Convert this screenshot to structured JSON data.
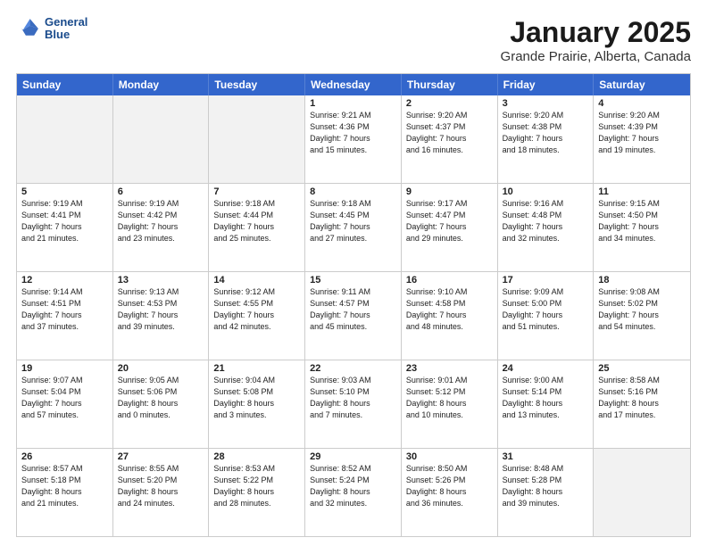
{
  "header": {
    "logo_line1": "General",
    "logo_line2": "Blue",
    "month": "January 2025",
    "location": "Grande Prairie, Alberta, Canada"
  },
  "days_of_week": [
    "Sunday",
    "Monday",
    "Tuesday",
    "Wednesday",
    "Thursday",
    "Friday",
    "Saturday"
  ],
  "weeks": [
    [
      {
        "day": "",
        "info": "",
        "shaded": true
      },
      {
        "day": "",
        "info": "",
        "shaded": true
      },
      {
        "day": "",
        "info": "",
        "shaded": true
      },
      {
        "day": "1",
        "info": "Sunrise: 9:21 AM\nSunset: 4:36 PM\nDaylight: 7 hours\nand 15 minutes.",
        "shaded": false
      },
      {
        "day": "2",
        "info": "Sunrise: 9:20 AM\nSunset: 4:37 PM\nDaylight: 7 hours\nand 16 minutes.",
        "shaded": false
      },
      {
        "day": "3",
        "info": "Sunrise: 9:20 AM\nSunset: 4:38 PM\nDaylight: 7 hours\nand 18 minutes.",
        "shaded": false
      },
      {
        "day": "4",
        "info": "Sunrise: 9:20 AM\nSunset: 4:39 PM\nDaylight: 7 hours\nand 19 minutes.",
        "shaded": false
      }
    ],
    [
      {
        "day": "5",
        "info": "Sunrise: 9:19 AM\nSunset: 4:41 PM\nDaylight: 7 hours\nand 21 minutes.",
        "shaded": false
      },
      {
        "day": "6",
        "info": "Sunrise: 9:19 AM\nSunset: 4:42 PM\nDaylight: 7 hours\nand 23 minutes.",
        "shaded": false
      },
      {
        "day": "7",
        "info": "Sunrise: 9:18 AM\nSunset: 4:44 PM\nDaylight: 7 hours\nand 25 minutes.",
        "shaded": false
      },
      {
        "day": "8",
        "info": "Sunrise: 9:18 AM\nSunset: 4:45 PM\nDaylight: 7 hours\nand 27 minutes.",
        "shaded": false
      },
      {
        "day": "9",
        "info": "Sunrise: 9:17 AM\nSunset: 4:47 PM\nDaylight: 7 hours\nand 29 minutes.",
        "shaded": false
      },
      {
        "day": "10",
        "info": "Sunrise: 9:16 AM\nSunset: 4:48 PM\nDaylight: 7 hours\nand 32 minutes.",
        "shaded": false
      },
      {
        "day": "11",
        "info": "Sunrise: 9:15 AM\nSunset: 4:50 PM\nDaylight: 7 hours\nand 34 minutes.",
        "shaded": false
      }
    ],
    [
      {
        "day": "12",
        "info": "Sunrise: 9:14 AM\nSunset: 4:51 PM\nDaylight: 7 hours\nand 37 minutes.",
        "shaded": false
      },
      {
        "day": "13",
        "info": "Sunrise: 9:13 AM\nSunset: 4:53 PM\nDaylight: 7 hours\nand 39 minutes.",
        "shaded": false
      },
      {
        "day": "14",
        "info": "Sunrise: 9:12 AM\nSunset: 4:55 PM\nDaylight: 7 hours\nand 42 minutes.",
        "shaded": false
      },
      {
        "day": "15",
        "info": "Sunrise: 9:11 AM\nSunset: 4:57 PM\nDaylight: 7 hours\nand 45 minutes.",
        "shaded": false
      },
      {
        "day": "16",
        "info": "Sunrise: 9:10 AM\nSunset: 4:58 PM\nDaylight: 7 hours\nand 48 minutes.",
        "shaded": false
      },
      {
        "day": "17",
        "info": "Sunrise: 9:09 AM\nSunset: 5:00 PM\nDaylight: 7 hours\nand 51 minutes.",
        "shaded": false
      },
      {
        "day": "18",
        "info": "Sunrise: 9:08 AM\nSunset: 5:02 PM\nDaylight: 7 hours\nand 54 minutes.",
        "shaded": false
      }
    ],
    [
      {
        "day": "19",
        "info": "Sunrise: 9:07 AM\nSunset: 5:04 PM\nDaylight: 7 hours\nand 57 minutes.",
        "shaded": false
      },
      {
        "day": "20",
        "info": "Sunrise: 9:05 AM\nSunset: 5:06 PM\nDaylight: 8 hours\nand 0 minutes.",
        "shaded": false
      },
      {
        "day": "21",
        "info": "Sunrise: 9:04 AM\nSunset: 5:08 PM\nDaylight: 8 hours\nand 3 minutes.",
        "shaded": false
      },
      {
        "day": "22",
        "info": "Sunrise: 9:03 AM\nSunset: 5:10 PM\nDaylight: 8 hours\nand 7 minutes.",
        "shaded": false
      },
      {
        "day": "23",
        "info": "Sunrise: 9:01 AM\nSunset: 5:12 PM\nDaylight: 8 hours\nand 10 minutes.",
        "shaded": false
      },
      {
        "day": "24",
        "info": "Sunrise: 9:00 AM\nSunset: 5:14 PM\nDaylight: 8 hours\nand 13 minutes.",
        "shaded": false
      },
      {
        "day": "25",
        "info": "Sunrise: 8:58 AM\nSunset: 5:16 PM\nDaylight: 8 hours\nand 17 minutes.",
        "shaded": false
      }
    ],
    [
      {
        "day": "26",
        "info": "Sunrise: 8:57 AM\nSunset: 5:18 PM\nDaylight: 8 hours\nand 21 minutes.",
        "shaded": false
      },
      {
        "day": "27",
        "info": "Sunrise: 8:55 AM\nSunset: 5:20 PM\nDaylight: 8 hours\nand 24 minutes.",
        "shaded": false
      },
      {
        "day": "28",
        "info": "Sunrise: 8:53 AM\nSunset: 5:22 PM\nDaylight: 8 hours\nand 28 minutes.",
        "shaded": false
      },
      {
        "day": "29",
        "info": "Sunrise: 8:52 AM\nSunset: 5:24 PM\nDaylight: 8 hours\nand 32 minutes.",
        "shaded": false
      },
      {
        "day": "30",
        "info": "Sunrise: 8:50 AM\nSunset: 5:26 PM\nDaylight: 8 hours\nand 36 minutes.",
        "shaded": false
      },
      {
        "day": "31",
        "info": "Sunrise: 8:48 AM\nSunset: 5:28 PM\nDaylight: 8 hours\nand 39 minutes.",
        "shaded": false
      },
      {
        "day": "",
        "info": "",
        "shaded": true
      }
    ]
  ]
}
